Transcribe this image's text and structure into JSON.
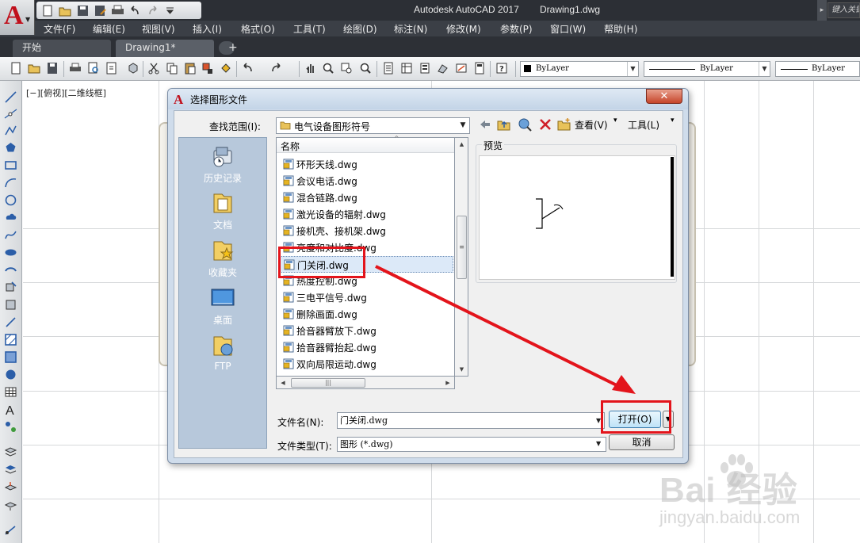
{
  "app": {
    "title": "Autodesk AutoCAD 2017",
    "document": "Drawing1.dwg",
    "search_placeholder": "键入关键",
    "logo_letter": "A"
  },
  "menu": [
    "文件(F)",
    "编辑(E)",
    "视图(V)",
    "插入(I)",
    "格式(O)",
    "工具(T)",
    "绘图(D)",
    "标注(N)",
    "修改(M)",
    "参数(P)",
    "窗口(W)",
    "帮助(H)"
  ],
  "tabs": {
    "start": "开始",
    "drawing": "Drawing1*",
    "add": "+"
  },
  "toolbar": {
    "color_combo": "ByLayer",
    "linetype_combo": "ByLayer",
    "lineweight_combo": "ByLayer"
  },
  "viewport_label": "[−][俯视][二维线框]",
  "dialog": {
    "title": "选择图形文件",
    "close": "✕",
    "look_in_label": "查找范围(I):",
    "look_in_value": "电气设备图形符号",
    "view_label": "查看(V)",
    "tools_label": "工具(L)",
    "places": [
      "历史记录",
      "文档",
      "收藏夹",
      "桌面",
      "FTP"
    ],
    "list_header": "名称",
    "files": [
      "环形天线.dwg",
      "会议电话.dwg",
      "混合链路.dwg",
      "激光设备的辐射.dwg",
      "接机壳、接机架.dwg",
      "亮度和对比度.dwg",
      "门关闭.dwg",
      "热度控制.dwg",
      "三电平信号.dwg",
      "删除画面.dwg",
      "拾音器臂放下.dwg",
      "拾音器臂抬起.dwg",
      "双向局限运动.dwg"
    ],
    "selected_index": 6,
    "preview_label": "预览",
    "filename_label": "文件名(N):",
    "filename_value": "门关闭.dwg",
    "filetype_label": "文件类型(T):",
    "filetype_value": "图形 (*.dwg)",
    "open_button": "打开(O)",
    "cancel_button": "取消"
  },
  "watermark": {
    "logo": "Bai  经验",
    "url": "jingyan.baidu.com"
  },
  "colors": {
    "accent_red": "#e3141b",
    "selection": "#dce9f8",
    "places_bg": "#b7c8db"
  }
}
